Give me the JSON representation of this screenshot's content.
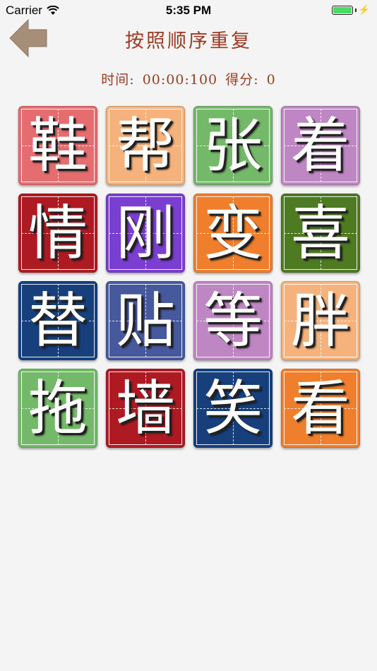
{
  "status_bar": {
    "carrier": "Carrier",
    "time": "5:35 PM"
  },
  "header": {
    "title": "按照顺序重复"
  },
  "score": {
    "time_label": "时间:",
    "time_value": "00:00:100",
    "score_label": "得分:",
    "score_value": "0"
  },
  "colors": {
    "title": "#9b3a22",
    "back_arrow": "#a68e78"
  },
  "tiles": [
    {
      "char": "鞋",
      "color": "#e56c6f"
    },
    {
      "char": "帮",
      "color": "#f5b27c"
    },
    {
      "char": "张",
      "color": "#74b86a"
    },
    {
      "char": "着",
      "color": "#bf86c4"
    },
    {
      "char": "情",
      "color": "#ad1a22"
    },
    {
      "char": "刚",
      "color": "#7a3fd0"
    },
    {
      "char": "变",
      "color": "#f07f2d"
    },
    {
      "char": "喜",
      "color": "#4e7a22"
    },
    {
      "char": "替",
      "color": "#173f7c"
    },
    {
      "char": "贴",
      "color": "#47599d"
    },
    {
      "char": "等",
      "color": "#bf86c4"
    },
    {
      "char": "胖",
      "color": "#f5b27c"
    },
    {
      "char": "拖",
      "color": "#74b86a"
    },
    {
      "char": "墙",
      "color": "#ad1a22"
    },
    {
      "char": "笑",
      "color": "#173f7c"
    },
    {
      "char": "看",
      "color": "#f07f2d"
    }
  ]
}
